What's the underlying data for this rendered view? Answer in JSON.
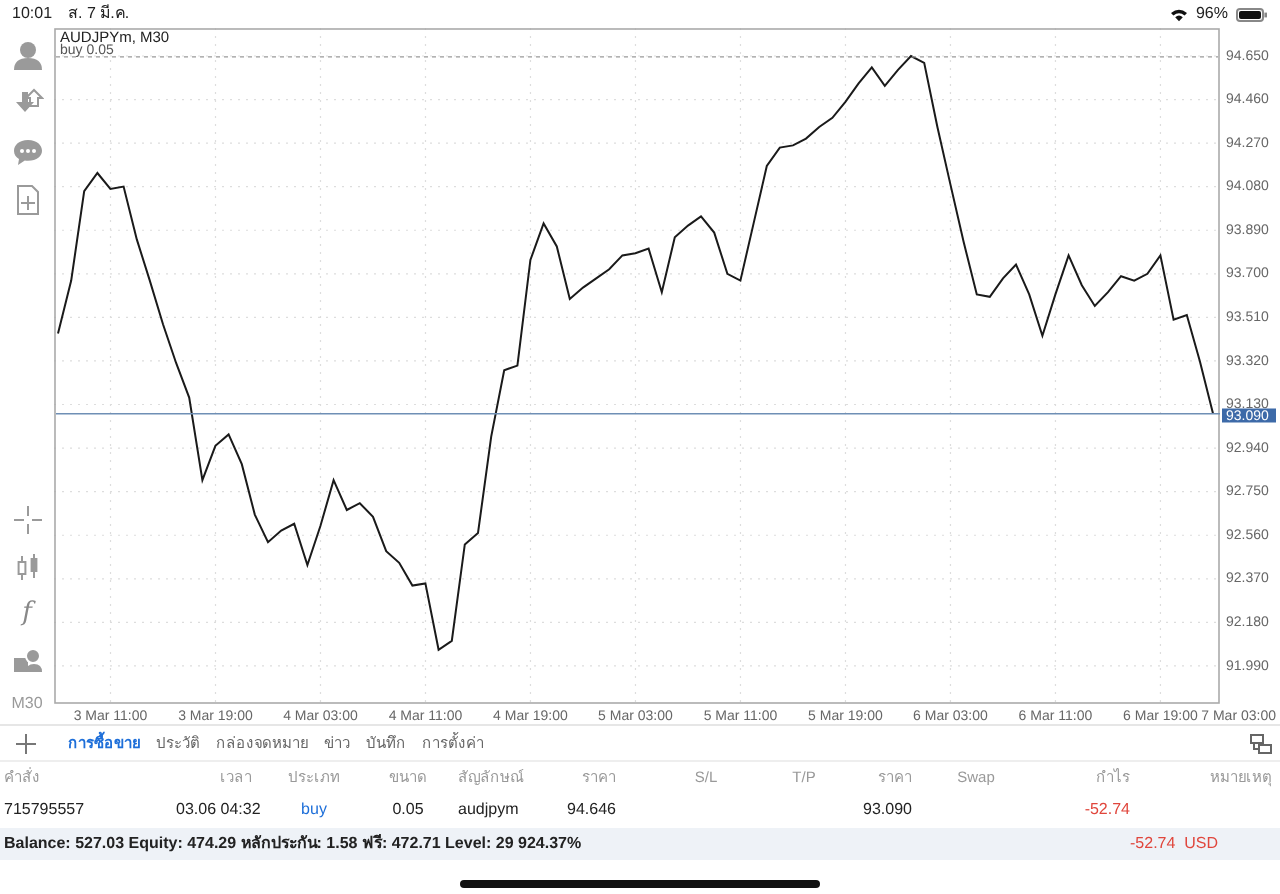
{
  "status_bar": {
    "time": "10:01",
    "date": "ส. 7 มี.ค.",
    "battery": "96%"
  },
  "toolbar": {
    "function_glyph": "f",
    "timeframe": "M30"
  },
  "chart": {
    "title": "AUDJPYm, M30",
    "chart_data": {
      "type": "line",
      "categories": [
        null,
        null,
        null,
        null,
        "3 Mar 11:00",
        null,
        null,
        null,
        null,
        null,
        null,
        null,
        "3 Mar 19:00",
        null,
        null,
        null,
        null,
        null,
        null,
        null,
        "4 Mar 03:00",
        null,
        null,
        null,
        null,
        null,
        null,
        null,
        "4 Mar 11:00",
        null,
        null,
        null,
        null,
        null,
        null,
        null,
        "4 Mar 19:00",
        null,
        null,
        null,
        null,
        null,
        null,
        null,
        "5 Mar 03:00",
        null,
        null,
        null,
        null,
        null,
        null,
        null,
        "5 Mar 11:00",
        null,
        null,
        null,
        null,
        null,
        null,
        null,
        "5 Mar 19:00",
        null,
        null,
        null,
        null,
        null,
        null,
        null,
        "6 Mar 03:00",
        null,
        null,
        null,
        null,
        null,
        null,
        null,
        "6 Mar 11:00",
        null,
        null,
        null,
        null,
        null,
        null,
        null,
        "6 Mar 19:00",
        null,
        null,
        null,
        null,
        null,
        "7 Mar 03:00"
      ],
      "series": [
        {
          "color": "#1a1a1a",
          "values": [
            93.44,
            93.67,
            94.06,
            94.14,
            94.07,
            94.08,
            93.85,
            93.67,
            93.48,
            93.31,
            93.16,
            92.8,
            92.95,
            93.0,
            92.87,
            92.65,
            92.53,
            92.58,
            92.61,
            92.43,
            92.6,
            92.8,
            92.67,
            92.7,
            92.64,
            92.49,
            92.44,
            92.34,
            92.35,
            92.06,
            92.1,
            92.52,
            92.57,
            92.99,
            93.28,
            93.3,
            93.76,
            93.92,
            93.82,
            93.59,
            93.64,
            93.68,
            93.72,
            93.78,
            93.79,
            93.81,
            93.62,
            93.86,
            93.91,
            93.95,
            93.88,
            93.7,
            93.67,
            93.92,
            94.17,
            94.25,
            94.26,
            94.29,
            94.34,
            94.38,
            94.45,
            94.53,
            94.6,
            94.52,
            94.59,
            94.65,
            94.62,
            94.34,
            94.09,
            93.84,
            93.61,
            93.6,
            93.68,
            93.74,
            93.61,
            93.43,
            93.61,
            93.78,
            93.65,
            93.56,
            93.62,
            93.69,
            93.67,
            93.7,
            93.78,
            93.5,
            93.52,
            93.32,
            93.09,
            null,
            null
          ]
        }
      ],
      "ylim": [
        91.824,
        94.772
      ],
      "grid": true,
      "yticks": [
        {
          "value": 94.65,
          "label": "94.650"
        },
        {
          "value": 94.46,
          "label": "94.460"
        },
        {
          "value": 94.27,
          "label": "94.270"
        },
        {
          "value": 94.08,
          "label": "94.080"
        },
        {
          "value": 93.89,
          "label": "93.890"
        },
        {
          "value": 93.7,
          "label": "93.700"
        },
        {
          "value": 93.51,
          "label": "93.510"
        },
        {
          "value": 93.32,
          "label": "93.320"
        },
        {
          "value": 93.13,
          "label": "93.130"
        },
        {
          "value": 92.94,
          "label": "92.940"
        },
        {
          "value": 92.75,
          "label": "92.750"
        },
        {
          "value": 92.56,
          "label": "92.560"
        },
        {
          "value": 92.37,
          "label": "92.370"
        },
        {
          "value": 92.18,
          "label": "92.180"
        },
        {
          "value": 91.99,
          "label": "91.990"
        }
      ],
      "ref_lines": [
        {
          "axis": "y",
          "value": 94.646,
          "label": "buy 0.05"
        },
        {
          "axis": "y",
          "value": 93.09,
          "label": "93.090"
        }
      ]
    }
  },
  "tabs": [
    {
      "label": "การซื้อขาย",
      "selected": true
    },
    {
      "label": "ประวัติ",
      "selected": false
    },
    {
      "label": "กล่องจดหมาย",
      "selected": false
    },
    {
      "label": "ข่าว",
      "selected": false
    },
    {
      "label": "บันทึก",
      "selected": false
    },
    {
      "label": "การตั้งค่า",
      "selected": false
    }
  ],
  "table": {
    "columns": [
      "คำสั่ง",
      "เวลา",
      "ประเภท",
      "ขนาด",
      "สัญลักษณ์",
      "ราคา",
      "S/L",
      "T/P",
      "ราคา",
      "Swap",
      "กำไร",
      "หมายเหตุ"
    ],
    "rows": [
      {
        "cells": [
          "715795557",
          "03.06 04:32",
          "buy",
          "0.05",
          "audjpym",
          "94.646",
          null,
          null,
          "93.090",
          null,
          "-52.74",
          null
        ]
      }
    ]
  },
  "summary": {
    "text": "Balance: 527.03 Equity: 474.29 หลักประกัน: 1.58 ฟรี: 472.71 Level: 29 924.37%",
    "profit": "-52.74",
    "currency": "USD"
  }
}
